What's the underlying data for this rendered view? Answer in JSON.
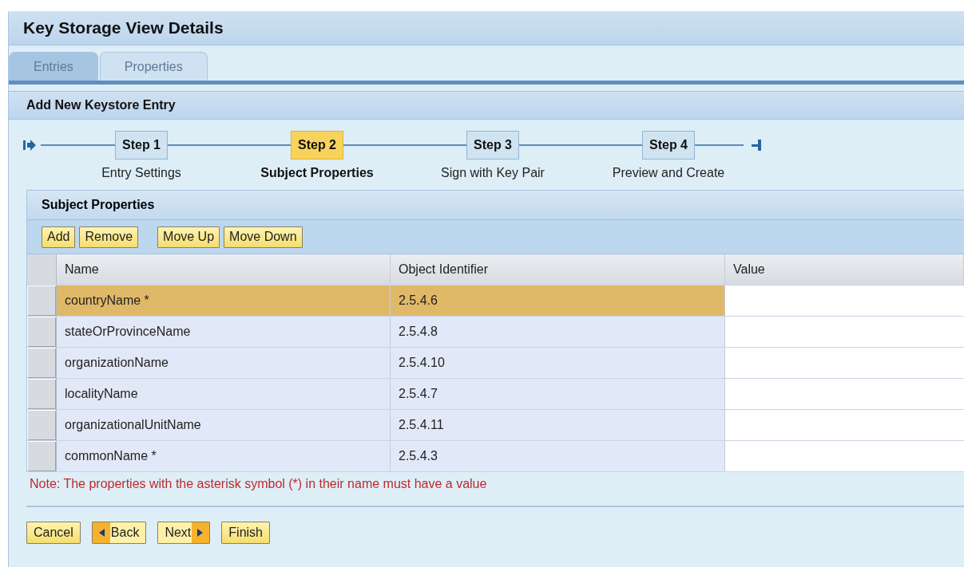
{
  "window": {
    "title": "Key Storage View Details"
  },
  "tabs": [
    {
      "label": "Entries",
      "selected": true,
      "disabled": true
    },
    {
      "label": "Properties",
      "selected": false,
      "disabled": true
    }
  ],
  "wizard": {
    "title": "Add New Keystore Entry",
    "steps": [
      {
        "label": "Step 1",
        "caption": "Entry Settings",
        "selected": false
      },
      {
        "label": "Step 2",
        "caption": "Subject Properties",
        "selected": true
      },
      {
        "label": "Step 3",
        "caption": "Sign with Key Pair",
        "selected": false
      },
      {
        "label": "Step 4",
        "caption": "Preview and Create",
        "selected": false
      }
    ]
  },
  "panel": {
    "title": "Subject Properties",
    "toolbar": [
      [
        "Add",
        "Remove"
      ],
      [
        "Move Up",
        "Move Down"
      ]
    ],
    "table": {
      "columns": [
        "Name",
        "Object Identifier",
        "Value"
      ],
      "rows": [
        {
          "name": "countryName *",
          "oid": "2.5.4.6",
          "selected": true
        },
        {
          "name": "stateOrProvinceName",
          "oid": "2.5.4.8",
          "selected": false
        },
        {
          "name": "organizationName",
          "oid": "2.5.4.10",
          "selected": false
        },
        {
          "name": "localityName",
          "oid": "2.5.4.7",
          "selected": false
        },
        {
          "name": "organizationalUnitName",
          "oid": "2.5.4.11",
          "selected": false
        },
        {
          "name": "commonName *",
          "oid": "2.5.4.3",
          "selected": false
        }
      ]
    },
    "note": "Note: The properties with the asterisk symbol (*) in their name must have a value"
  },
  "buttons": [
    {
      "label": "Cancel",
      "kind": "plain"
    },
    {
      "label": "Back",
      "kind": "back"
    },
    {
      "label": "Next",
      "kind": "next"
    },
    {
      "label": "Finish",
      "kind": "plain"
    }
  ]
}
